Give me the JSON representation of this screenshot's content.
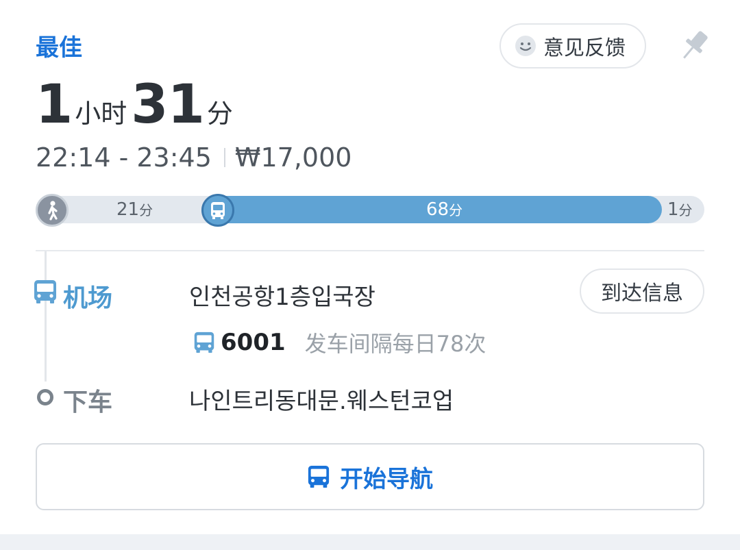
{
  "header": {
    "tag": "最佳",
    "feedback_label": "意见反馈"
  },
  "summary": {
    "hours": "1",
    "hours_unit": "小时",
    "minutes": "31",
    "minutes_unit": "分",
    "time_range": "22:14 - 23:45",
    "fare": "₩17,000"
  },
  "timeline": {
    "walk_minutes": "21",
    "bus_minutes": "68",
    "end_minutes": "1",
    "unit": "分"
  },
  "route": {
    "board_label": "机场",
    "board_stop": "인천공항1층입국장",
    "arrival_button": "到达信息",
    "bus_line": "6001",
    "interval": "发车间隔每日78次",
    "alight_label": "下车",
    "alight_stop": "나인트리동대문.웨스턴코업"
  },
  "actions": {
    "start_nav": "开始导航"
  },
  "colors": {
    "accent": "#1a73d9",
    "bus": "#5fa3d4",
    "muted": "#9aa1a8"
  }
}
